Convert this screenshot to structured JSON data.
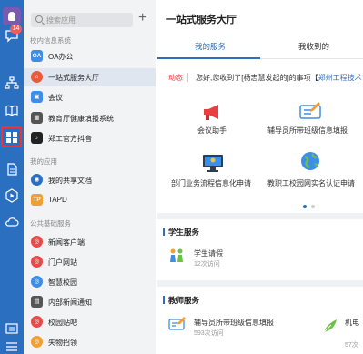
{
  "rail": {
    "badge": "14",
    "icons": [
      "avatar-icon",
      "chat-icon",
      "org-icon",
      "book-icon",
      "apps-grid-icon",
      "doc-icon",
      "play-icon",
      "cloud-icon",
      "menu-icon",
      "settings-icon"
    ]
  },
  "panel": {
    "search_placeholder": "搜索应用",
    "add_label": "+",
    "sections": [
      {
        "title": "校内信息系统",
        "items": [
          {
            "label": "OA办公",
            "icon_text": "OA",
            "color": "#3d8ee8"
          },
          {
            "label": "一站式服务大厅",
            "icon_text": "⌂",
            "color": "#e85b3d",
            "selected": true
          },
          {
            "label": "会议",
            "icon_text": "▣",
            "color": "#3d8ee8"
          },
          {
            "label": "教育厅健康填报系统",
            "icon_text": "▦",
            "color": "#555"
          },
          {
            "label": "郑工官方抖音",
            "icon_text": "♪",
            "color": "#222"
          }
        ]
      },
      {
        "title": "我的应用",
        "items": [
          {
            "label": "我的共享文档",
            "icon_text": "◉",
            "color": "#2b6fc0"
          },
          {
            "label": "TAPD",
            "icon_text": "TP",
            "color": "#f0a030"
          }
        ]
      },
      {
        "title": "公共基础服务",
        "items": [
          {
            "label": "新闻客户端",
            "icon_text": "◎",
            "color": "#e84a4a"
          },
          {
            "label": "门户网站",
            "icon_text": "◎",
            "color": "#e84a4a"
          },
          {
            "label": "智慧校园",
            "icon_text": "◎",
            "color": "#3d8ee8"
          },
          {
            "label": "内部新闻通知",
            "icon_text": "▤",
            "color": "#555"
          },
          {
            "label": "校园贴吧",
            "icon_text": "◎",
            "color": "#e84a4a"
          },
          {
            "label": "失物招领",
            "icon_text": "◎",
            "color": "#f0a030"
          }
        ]
      }
    ]
  },
  "main": {
    "title": "一站式服务大厅",
    "tabs": [
      "我的服务",
      "我收到的"
    ],
    "notice": {
      "tag": "动态",
      "text_prefix": "您好,您收到了[杨志慧发起的]的事项【",
      "text_link": "郑州工程技术"
    },
    "grid": [
      {
        "label": "会议助手",
        "icon": "megaphone-icon"
      },
      {
        "label": "辅导员所带班级信息填报",
        "icon": "pencil-card-icon"
      },
      {
        "label": "部门业务流程信息化申请",
        "icon": "monitor-icon"
      },
      {
        "label": "教职工校园网实名认证申请",
        "icon": "globe-icon"
      }
    ],
    "student_section": {
      "title": "学生服务",
      "items": [
        {
          "name": "学生请假",
          "visits": "12次访问"
        }
      ]
    },
    "teacher_section": {
      "title": "教师服务",
      "items": [
        {
          "name": "辅导员所带班级信息填报",
          "visits": "593次访问"
        },
        {
          "name": "机电",
          "visits": "57次"
        }
      ]
    }
  }
}
